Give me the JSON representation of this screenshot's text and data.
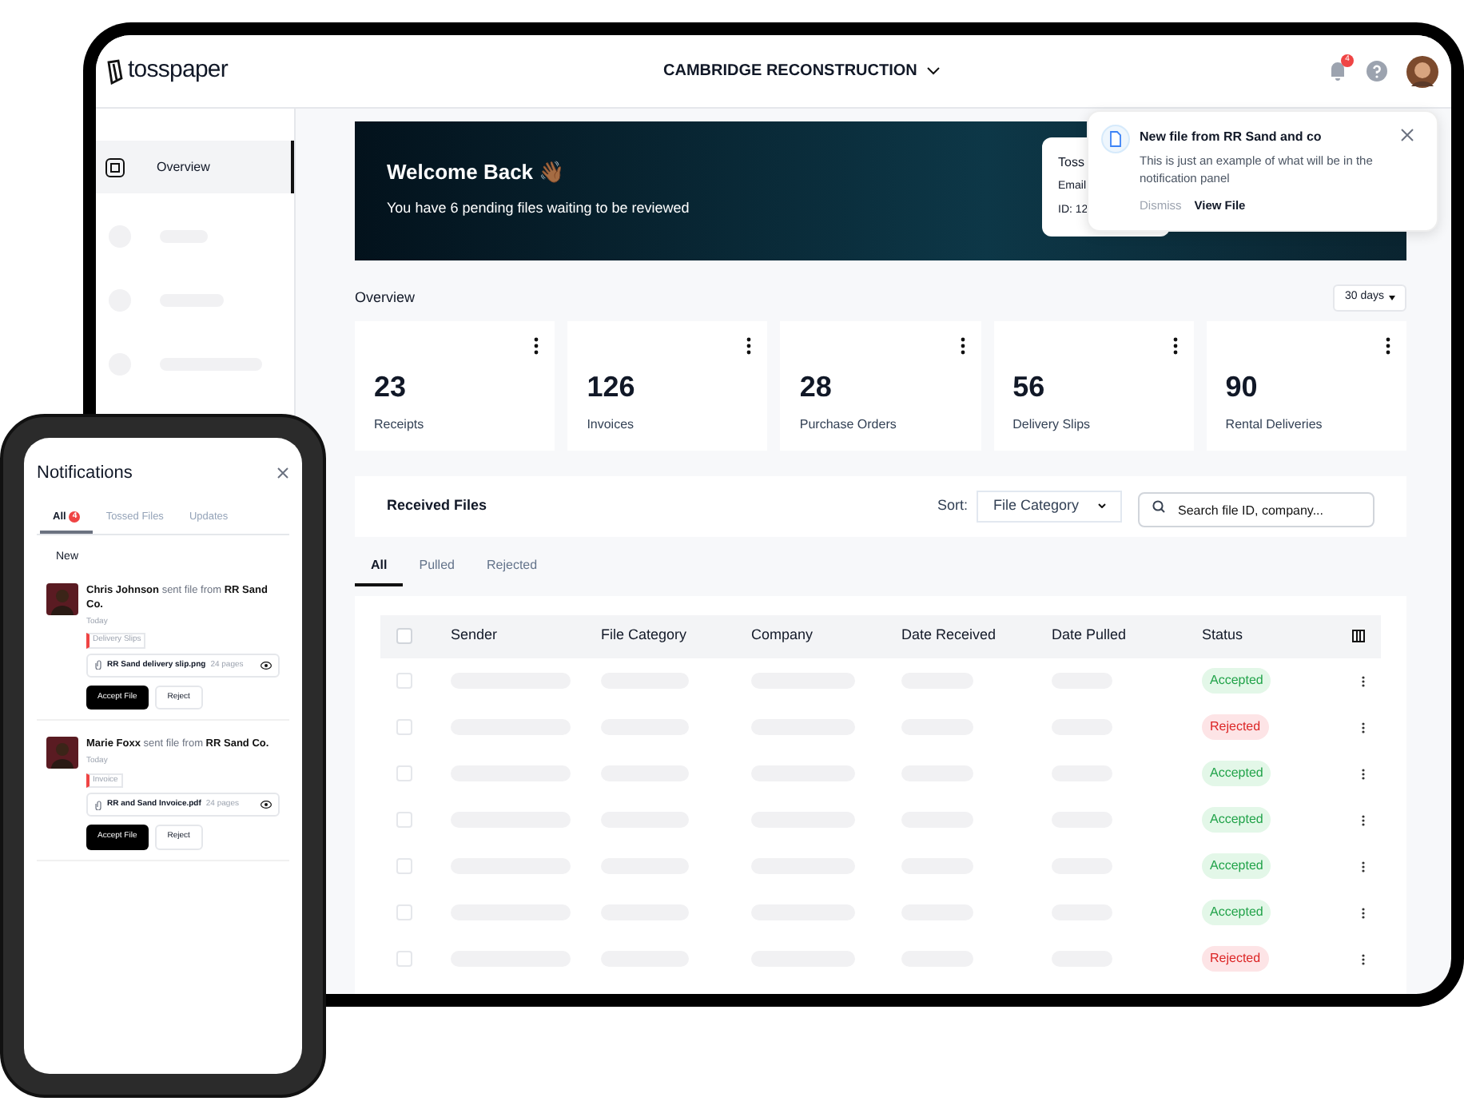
{
  "header": {
    "logo": "tosspaper",
    "project": "CAMBRIDGE RECONSTRUCTION",
    "notification_count": "4"
  },
  "sidebar": {
    "items": [
      {
        "label": "Overview",
        "selected": true
      }
    ]
  },
  "banner": {
    "title": "Welcome Back 👋🏾",
    "subtitle": "You have 6 pending files waiting to be reviewed",
    "card_lines": [
      "Toss",
      "Email",
      "ID: 12"
    ]
  },
  "toast": {
    "title": "New file from RR Sand and co",
    "message": "This is just an example of what will be in the notification panel",
    "actions": [
      "Dismiss",
      "View File"
    ]
  },
  "overview": {
    "title": "Overview",
    "period": "30 days",
    "stats": [
      {
        "value": "23",
        "label": "Receipts"
      },
      {
        "value": "126",
        "label": "Invoices"
      },
      {
        "value": "28",
        "label": "Purchase Orders"
      },
      {
        "value": "56",
        "label": "Delivery Slips"
      },
      {
        "value": "90",
        "label": "Rental Deliveries"
      }
    ]
  },
  "received_files": {
    "title": "Received Files",
    "sort_label": "Sort:",
    "sort_value": "File Category",
    "search_placeholder": "Search file ID, company...",
    "tabs": [
      {
        "label": "All",
        "selected": true
      },
      {
        "label": "Pulled",
        "selected": false
      },
      {
        "label": "Rejected",
        "selected": false
      }
    ],
    "select_all_checked": false,
    "columns": [
      "Sender",
      "File Category",
      "Company",
      "Date Received",
      "Date Pulled",
      "Status"
    ],
    "rows": [
      {
        "checked": false,
        "status": "Accepted",
        "kind": "accepted"
      },
      {
        "checked": false,
        "status": "Rejected",
        "kind": "rejected"
      },
      {
        "checked": false,
        "status": "Accepted",
        "kind": "accepted"
      },
      {
        "checked": false,
        "status": "Accepted",
        "kind": "accepted"
      },
      {
        "checked": false,
        "status": "Accepted",
        "kind": "accepted"
      },
      {
        "checked": false,
        "status": "Accepted",
        "kind": "accepted"
      },
      {
        "checked": false,
        "status": "Rejected",
        "kind": "rejected"
      }
    ]
  },
  "phone": {
    "title": "Notifications",
    "tabs": [
      {
        "label": "All",
        "selected": true,
        "count": "4"
      },
      {
        "label": "Tossed Files",
        "selected": false
      },
      {
        "label": "Updates",
        "selected": false
      }
    ],
    "section": "New",
    "items": [
      {
        "text": "**Chris Johnson** sent file from **RR Sand Co.**",
        "time": "Today",
        "tag": "Delivery Slips",
        "file": "RR Sand delivery slip.png",
        "pages": "24 pages",
        "actions": [
          "Accept File",
          "Reject"
        ]
      },
      {
        "text": "**Marie Foxx** sent file from **RR Sand Co.**",
        "time": "Today",
        "tag": "Invoice",
        "file": "RR and Sand Invoice.pdf",
        "pages": "24 pages",
        "actions": [
          "Accept File",
          "Reject"
        ]
      }
    ]
  }
}
